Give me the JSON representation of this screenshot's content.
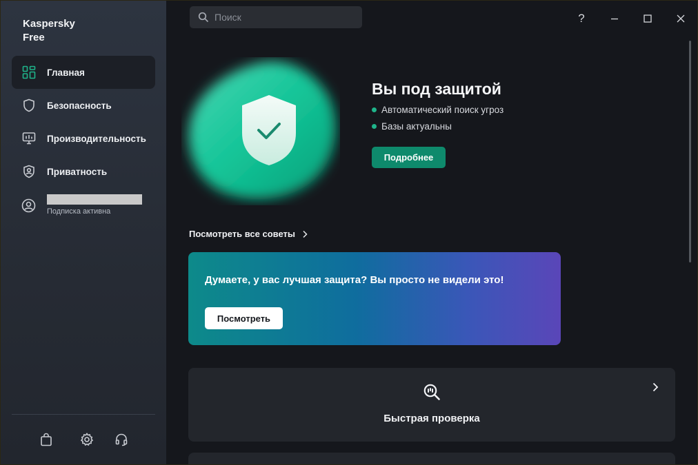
{
  "app": {
    "brand": "Kaspersky\nFree"
  },
  "sidebar": {
    "items": [
      {
        "label": "Главная",
        "icon": "home-grid-icon",
        "active": true
      },
      {
        "label": "Безопасность",
        "icon": "shield-icon"
      },
      {
        "label": "Производительность",
        "icon": "monitor-performance-icon"
      },
      {
        "label": "Приватность",
        "icon": "privacy-shield-icon"
      }
    ],
    "account": {
      "subtitle": "Подписка активна",
      "icon": "user-circle-icon"
    },
    "bottom_icons": [
      "store-bag-icon",
      "gear-icon",
      "headset-icon"
    ]
  },
  "search": {
    "placeholder": "Поиск"
  },
  "window_controls": {
    "help": "?"
  },
  "hero": {
    "title": "Вы под защитой",
    "status": [
      "Автоматический поиск угроз",
      "Базы актуальны"
    ],
    "details_button": "Подробнее"
  },
  "tips": {
    "link": "Посмотреть все советы"
  },
  "promo": {
    "text": "Думаете, у вас лучшая защита? Вы просто не видели это!",
    "button": "Посмотреть"
  },
  "quick_scan": {
    "label": "Быстрая проверка"
  },
  "colors": {
    "accent": "#0e8a6c",
    "status_dot": "#1fb48a"
  }
}
